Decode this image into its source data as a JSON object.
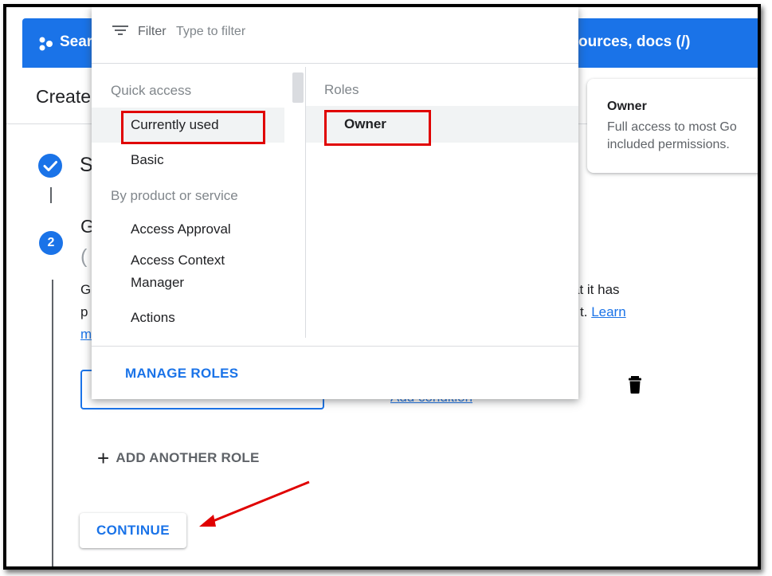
{
  "search": {
    "label": "Sear",
    "hint": "ources, docs (/)"
  },
  "page": {
    "title": "Create"
  },
  "steps": [
    {
      "label": "S"
    },
    {
      "number": "2",
      "label": "G",
      "sub_label": "(",
      "body_left_1": "G",
      "body_left_2": "p",
      "body_left_3": "m",
      "body_right_1": "at it has",
      "body_right_2": "t.",
      "learn_link": "Learn"
    }
  ],
  "role_row": {
    "add_condition": "Add condition"
  },
  "add_another_role": {
    "label": "ADD ANOTHER ROLE"
  },
  "continue": {
    "label": "CONTINUE"
  },
  "owner_card": {
    "title": "Owner",
    "desc_line1": "Full access to most Go",
    "desc_line2": "included permissions."
  },
  "menu": {
    "filter": {
      "label": "Filter",
      "placeholder": "Type to filter"
    },
    "categories": {
      "quick_access_heading": "Quick access",
      "currently_used": "Currently used",
      "basic": "Basic",
      "by_product_heading": "By product or service",
      "access_approval": "Access Approval",
      "access_context_line1": "Access Context",
      "access_context_line2": "Manager",
      "actions": "Actions"
    },
    "roles": {
      "heading": "Roles",
      "owner": "Owner"
    },
    "manage_roles": "MANAGE ROLES"
  },
  "annotations": {
    "highlight_color": "#e00000",
    "accent_color": "#1a73e8"
  }
}
